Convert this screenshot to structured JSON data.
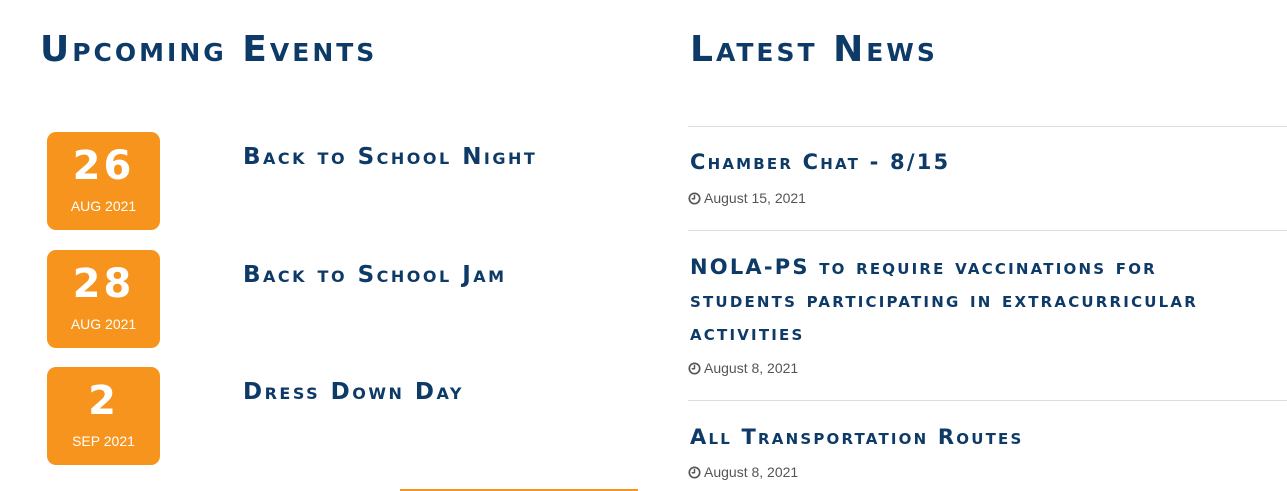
{
  "events": {
    "heading": "Upcoming Events",
    "items": [
      {
        "day": "26",
        "month": "AUG 2021",
        "title": "Back to School Night"
      },
      {
        "day": "28",
        "month": "AUG 2021",
        "title": "Back to School Jam"
      },
      {
        "day": "2",
        "month": "SEP 2021",
        "title": "Dress Down Day"
      }
    ]
  },
  "news": {
    "heading": "Latest News",
    "items": [
      {
        "title": "Chamber Chat - 8/15",
        "date": "August 15, 2021",
        "icon": "clock-icon"
      },
      {
        "title": "NOLA-PS to require vaccinations for students participating in extracurricular activities",
        "date": "August 8, 2021",
        "icon": "clock-icon"
      },
      {
        "title": "All Transportation Routes",
        "date": "August 8, 2021",
        "icon": "clock-icon"
      }
    ]
  },
  "colors": {
    "navy": "#0d3a66",
    "orange": "#f7941d",
    "divider": "#dddddd",
    "meta_text": "#555555"
  }
}
